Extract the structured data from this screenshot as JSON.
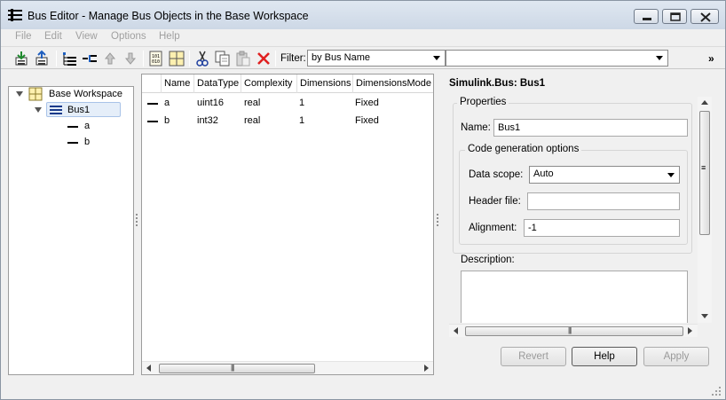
{
  "window": {
    "title": "Bus Editor - Manage Bus Objects in the Base Workspace"
  },
  "menu": [
    "File",
    "Edit",
    "View",
    "Options",
    "Help"
  ],
  "toolbar": {
    "filter_label": "Filter:",
    "filter_mode": "by Bus Name",
    "filter_text": "",
    "icons": [
      "import-icon",
      "export-icon",
      "add-bus-icon",
      "add-element-icon",
      "move-up-icon",
      "move-down-icon",
      "matlab-file-icon",
      "spreadsheet-icon",
      "cut-icon",
      "copy-icon",
      "paste-icon",
      "delete-icon"
    ]
  },
  "tree": {
    "root": "Base Workspace",
    "bus": "Bus1",
    "elements": [
      "a",
      "b"
    ]
  },
  "grid": {
    "columns": [
      "Name",
      "DataType",
      "Complexity",
      "Dimensions",
      "DimensionsMode"
    ],
    "rows": [
      {
        "name": "a",
        "datatype": "uint16",
        "complexity": "real",
        "dimensions": "1",
        "mode": "Fixed"
      },
      {
        "name": "b",
        "datatype": "int32",
        "complexity": "real",
        "dimensions": "1",
        "mode": "Fixed"
      }
    ]
  },
  "properties": {
    "title": "Simulink.Bus: Bus1",
    "group_label": "Properties",
    "name_label": "Name:",
    "name_value": "Bus1",
    "codegen_label": "Code generation options",
    "data_scope_label": "Data scope:",
    "data_scope_value": "Auto",
    "header_file_label": "Header file:",
    "header_file_value": "",
    "alignment_label": "Alignment:",
    "alignment_value": "-1",
    "description_label": "Description:",
    "description_value": ""
  },
  "buttons": {
    "revert": "Revert",
    "help": "Help",
    "apply": "Apply"
  }
}
